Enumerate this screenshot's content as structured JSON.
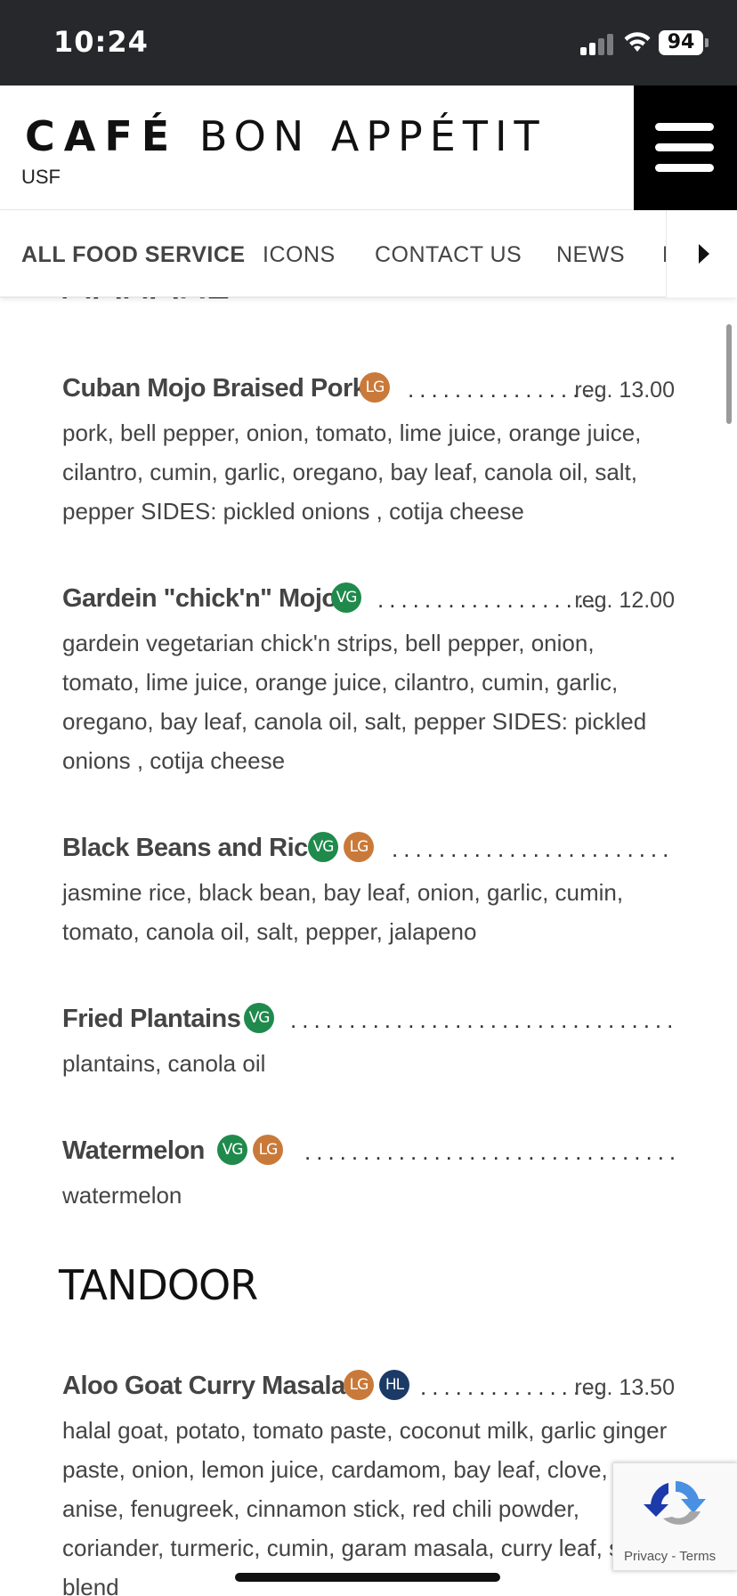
{
  "status_bar": {
    "time": "10:24",
    "battery": "94"
  },
  "header": {
    "logo_bold": "CAFÉ",
    "logo_light": "BON APPÉTIT",
    "subtitle": "USF",
    "menu_icon": "hamburger-menu-icon"
  },
  "nav": {
    "items": [
      {
        "label": "ALL FOOD SERVICE",
        "active": true
      },
      {
        "label": "ICONS",
        "active": false
      },
      {
        "label": "CONTACT US",
        "active": false
      },
      {
        "label": "NEWS",
        "active": false
      },
      {
        "label": "E",
        "active": false
      }
    ],
    "arrow_icon": "caret-right-icon"
  },
  "sections": [
    {
      "title": "MAHARE",
      "items": [
        {
          "name": "Cuban Mojo Braised Pork",
          "badges": [
            "LG"
          ],
          "price": "reg.  13.00",
          "description": "pork, bell pepper, onion, tomato, lime juice, orange juice, cilantro, cumin, garlic, oregano, bay leaf, canola oil, salt, pepper SIDES: pickled onions , cotija cheese"
        },
        {
          "name": "Gardein \"chick'n\" Mojo",
          "badges": [
            "VG"
          ],
          "price": "reg.  12.00",
          "description": "gardein vegetarian chick'n strips, bell pepper, onion, tomato, lime juice, orange juice, cilantro, cumin, garlic, oregano, bay leaf, canola oil, salt, pepper SIDES: pickled onions , cotija cheese"
        },
        {
          "name": "Black Beans and Rice",
          "badges": [
            "VG",
            "LG"
          ],
          "price": "",
          "description": "jasmine rice, black bean, bay leaf, onion, garlic, cumin, tomato, canola oil, salt, pepper, jalapeno"
        },
        {
          "name": "Fried Plantains",
          "badges": [
            "VG"
          ],
          "price": "",
          "description": "plantains, canola oil"
        },
        {
          "name": "Watermelon",
          "badges": [
            "VG",
            "LG"
          ],
          "price": "",
          "description": "watermelon"
        }
      ]
    },
    {
      "title": "TANDOOR",
      "items": [
        {
          "name": "Aloo Goat Curry Masala",
          "badges": [
            "LG",
            "HL"
          ],
          "price": "reg.  13.50",
          "description": "halal goat, potato, tomato paste, coconut milk, garlic ginger paste, onion, lemon juice, cardamom, bay leaf, clove, star anise, fenugreek, cinnamon stick, red chili powder, coriander, turmeric, cumin, garam masala, curry leaf, spice blend"
        }
      ]
    }
  ],
  "recaptcha": {
    "privacy": "Privacy",
    "separator": " - ",
    "terms": "Terms"
  },
  "colors": {
    "vg": "#1f8a4c",
    "lg": "#c97a3a",
    "hl": "#1b3a66",
    "status_bar": "#26282b"
  }
}
